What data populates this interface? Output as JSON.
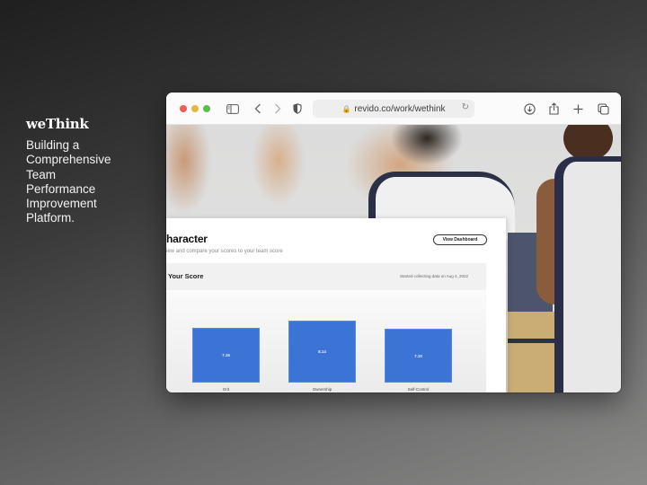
{
  "brand": {
    "logo": "weThink",
    "tagline": "Building a Comprehensive Team Performance Improvement Platform."
  },
  "browser": {
    "url": "revido.co/work/wethink",
    "icons": [
      "sidebar-icon",
      "back-icon",
      "forward-icon",
      "shield-icon",
      "lock-icon",
      "reload-icon",
      "download-icon",
      "share-icon",
      "new-tab-icon",
      "tabs-overview-icon"
    ]
  },
  "page": {
    "title": "haracter",
    "subtitle": "iew and compare your scores to your team score",
    "view_button": "View Dashboard",
    "panel": {
      "title": "Your Score",
      "note": "Started collecting data on Aug 4, 2022"
    }
  },
  "chart_data": {
    "type": "bar",
    "title": "Your Score",
    "categories": [
      "Grit",
      "Ownership",
      "Self-Control"
    ],
    "values": [
      7.16,
      8.14,
      7.1
    ],
    "value_labels": [
      "7.16",
      "8.14",
      "7.10"
    ],
    "ylim": [
      0,
      10
    ],
    "color": "#3c74d6",
    "grid": false
  }
}
